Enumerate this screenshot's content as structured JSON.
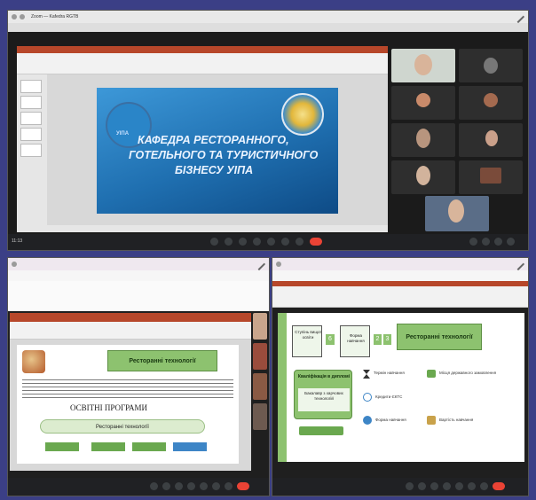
{
  "top_window": {
    "tab_title": "Zoom — Kafedra RGTB",
    "slide": {
      "title_line1": "КАФЕДРА РЕСТОРАННОГО,",
      "title_line2": "ГОТЕЛЬНОГО ТА ТУРИСТИЧНОГО",
      "title_line3": "БІЗНЕСУ УІПА",
      "logo_left_text": "УІПА",
      "bg_color": "#1f6fb0"
    },
    "participants": [
      "",
      "",
      "",
      "",
      "",
      "",
      "",
      "",
      "",
      ""
    ],
    "self_view_name": ""
  },
  "bottom_left_window": {
    "slide": {
      "banner": "Ресторанні технології",
      "heading": "ОСВІТНІ ПРОГРАМИ",
      "program_box": "Ресторанні технології"
    }
  },
  "bottom_right_window": {
    "slide": {
      "box1": "Ступінь вищої освіти",
      "box1_value": "6",
      "box2": "Форма навчання",
      "box2_value": "2",
      "box2_value2": "3",
      "program": "Ресторанні технології",
      "qualification_title": "Кваліфікація в дипломі",
      "qualification_text": "Бакалавр з харчових технологій",
      "green_button": "",
      "info_items": [
        "Термін навчання",
        "Кредити ЄКТС",
        "Форма навчання",
        "Місця державного замовлення",
        "Вартість навчання"
      ]
    }
  },
  "colors": {
    "frame_bg": "#3b3f86",
    "zoom_dark": "#1b1b1b",
    "leave_red": "#ea4335",
    "ppt_red": "#b7472a",
    "slide_green": "#8dc26f"
  }
}
